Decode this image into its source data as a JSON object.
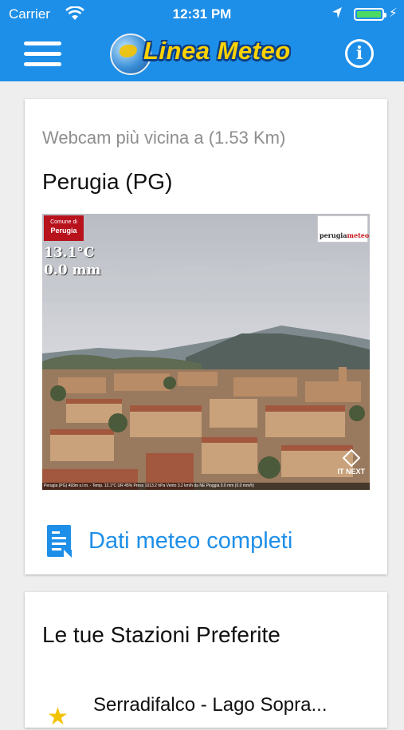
{
  "status_bar": {
    "carrier": "Carrier",
    "time": "12:31 PM",
    "battery_level": 1.0
  },
  "nav": {
    "logo_text": "Linea Meteo",
    "menu_icon": "hamburger-menu-icon",
    "info_icon": "info-icon",
    "bar_color": "#1e8fe8"
  },
  "webcam_card": {
    "subtitle": "Webcam più vicina a (1.53 Km)",
    "city": "Perugia (PG)",
    "overlay": {
      "badge_small": "Comune di",
      "badge_city": "Perugia",
      "logo_text_a": "perugia",
      "logo_text_b": "meteo.it",
      "temperature": "13.1°C",
      "precipitation": "0.0 mm",
      "brand": "IT NEXT",
      "info_bar": "Perugia (PG) 493m s.l.m. - Temp. 13.1°C UR 45% Press 1013.2 hPa Vento 3.2 km/h da NE Pioggia 0.0 mm (0.0 mm/h)"
    },
    "link_label": "Dati meteo completi",
    "link_icon": "document-chart-icon"
  },
  "favorites_card": {
    "title": "Le tue Stazioni Preferite",
    "items": [
      {
        "name": "Serradifalco - Lago Sopra...",
        "icon": "star-icon"
      }
    ]
  }
}
